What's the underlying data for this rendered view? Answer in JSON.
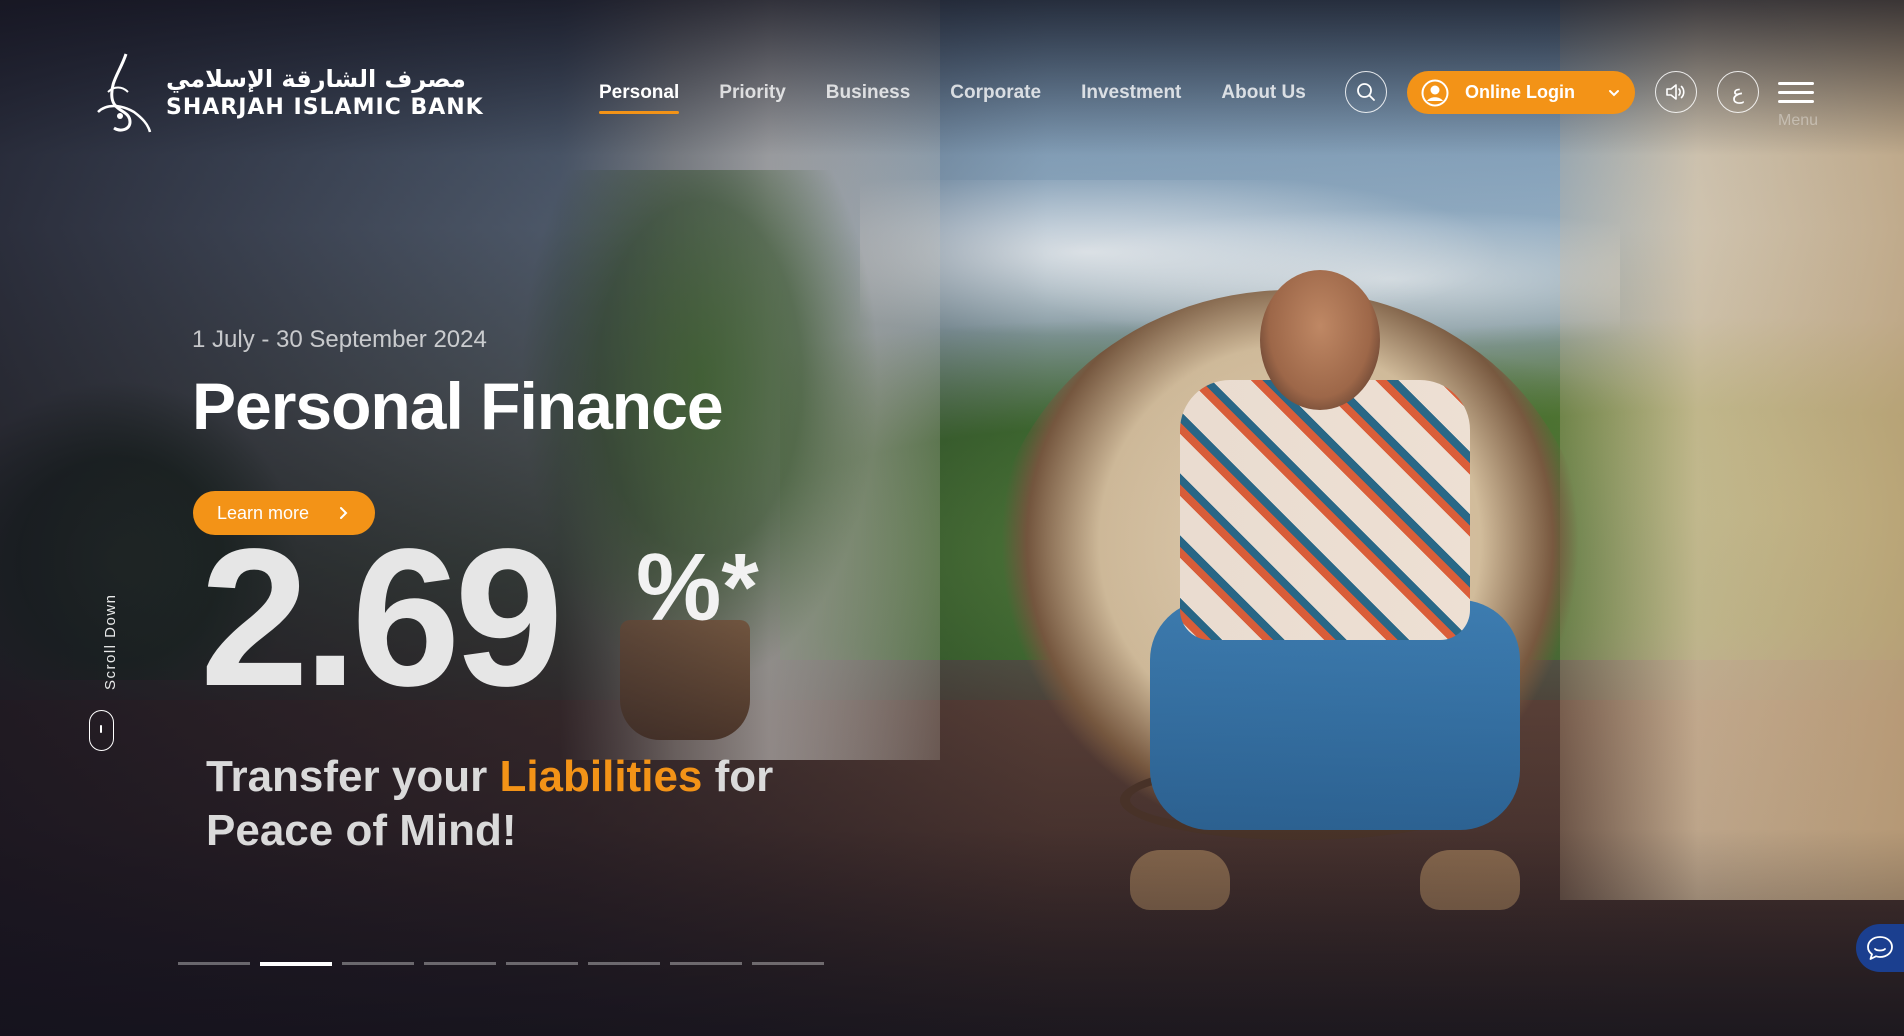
{
  "brand": {
    "name_ar": "مصرف الشارقة الإسلامي",
    "name_en": "SHARJAH ISLAMIC BANK"
  },
  "nav": {
    "items": [
      {
        "label": "Personal",
        "active": true
      },
      {
        "label": "Priority",
        "active": false
      },
      {
        "label": "Business",
        "active": false
      },
      {
        "label": "Corporate",
        "active": false
      },
      {
        "label": "Investment",
        "active": false
      },
      {
        "label": "About Us",
        "active": false
      }
    ]
  },
  "header": {
    "search_icon": "search-icon",
    "login_label": "Online Login",
    "login_icon": "user-circle-icon",
    "accessibility_icon": "speaker-icon",
    "language_label": "ع",
    "menu_label": "Menu"
  },
  "hero": {
    "date_range": "1 July - 30 September 2024",
    "title": "Personal Finance",
    "cta_label": "Learn more",
    "rate": "2.69",
    "rate_suffix": "%*",
    "tagline_before": "Transfer your ",
    "tagline_highlight": "Liabilities",
    "tagline_after": " for",
    "tagline_line2": "Peace of Mind!"
  },
  "scroll": {
    "label": "Scroll Down"
  },
  "slider": {
    "total": 8,
    "active_index": 1
  },
  "colors": {
    "accent": "#f39317",
    "chat": "#1b3f8f"
  }
}
